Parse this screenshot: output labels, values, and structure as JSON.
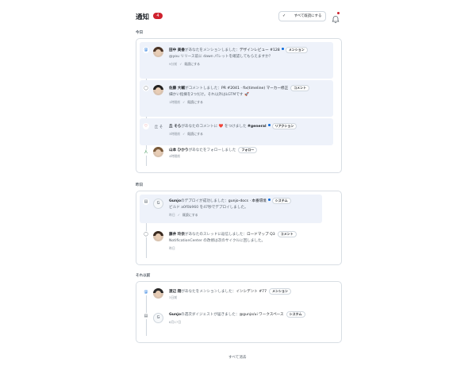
{
  "header": {
    "title": "通知",
    "unread_count": "4",
    "mark_all_read": "すべて既読にする"
  },
  "sections": [
    {
      "label": "今日",
      "items": [
        {
          "icon": "at-icon",
          "icon_glyph": "@",
          "actor": "田中 美香",
          "verb": "があなたをメンションしました：",
          "subject": "デザインレビュー #128",
          "tag": "メンション",
          "unread": true,
          "snippet": "@you リリース前に dawn パレットを確認してもらえますか？",
          "time": "9分前",
          "mark_read": "既読にする"
        },
        {
          "icon": "comment-icon",
          "icon_glyph": "💬",
          "actor": "佐藤 大輔",
          "verb": "がコメントしました：",
          "subject": "PR #2041 · fix(timeline) マーカー修正",
          "tag": "コメント",
          "unread": true,
          "snippet": "細かい指摘を2つだけ。それ以外はLGTMです 🚀",
          "time": "1時間前",
          "mark_read": "既読にする"
        },
        {
          "icon": "heart-icon",
          "icon_glyph": "♡",
          "avatar_text": "丘 そら",
          "actor": "丘 そら",
          "verb": "があなたのコメントに ❤️ をつけました",
          "subject": "#general",
          "tag": "リアクション",
          "unread": true,
          "snippet": "",
          "time": "3時間前",
          "mark_read": "既読にする"
        },
        {
          "icon": "person-icon",
          "icon_glyph": "人",
          "actor": "山本 ひかり",
          "verb": "があなたをフォローしました",
          "subject": "",
          "tag": "フォロー",
          "unread": false,
          "snippet": "",
          "time": "4時間前",
          "mark_read": ""
        }
      ]
    },
    {
      "label": "昨日",
      "items": [
        {
          "icon": "deploy-icon",
          "icon_glyph": "▤",
          "avatar_text": "G",
          "actor": "Gunjo",
          "verb": "のデプロイが成功しました：",
          "subject": "gunjo-docs · 本番環境",
          "tag": "システム",
          "unread": true,
          "snippet": "ビルド a0f0b960 を47秒でデプロイしました。",
          "time": "昨日",
          "mark_read": "既読にする"
        },
        {
          "icon": "comment-icon",
          "icon_glyph": "💬",
          "actor": "藤井 玲奈",
          "verb": "があなたのスレッドに返信しました：",
          "subject": "ロードマップ Q3",
          "tag": "コメント",
          "unread": false,
          "snippet": "NotificationCenter の改修は次のサイクルに回しました。",
          "time": "昨日",
          "mark_read": ""
        }
      ]
    },
    {
      "label": "それ以前",
      "items": [
        {
          "icon": "at-icon",
          "icon_glyph": "@",
          "actor": "渡辺 翔",
          "verb": "があなたをメンションしました：",
          "subject": "インシデント #77",
          "tag": "メンション",
          "unread": false,
          "snippet": "",
          "time": "3日前",
          "mark_read": ""
        },
        {
          "icon": "deploy-icon",
          "icon_glyph": "▤",
          "avatar_text": "G",
          "actor": "Gunjo",
          "verb": "の週次ダイジェストが届きました：",
          "subject": "@gunjo/ui ワークスペース",
          "tag": "システム",
          "unread": false,
          "snippet": "",
          "time": "6月17日",
          "mark_read": ""
        }
      ]
    }
  ],
  "footer": {
    "clear_all": "すべて消去"
  },
  "colors": {
    "badge": "#cf222e",
    "unread_bg": "#eef2fa",
    "unread_dot": "#0969da"
  }
}
